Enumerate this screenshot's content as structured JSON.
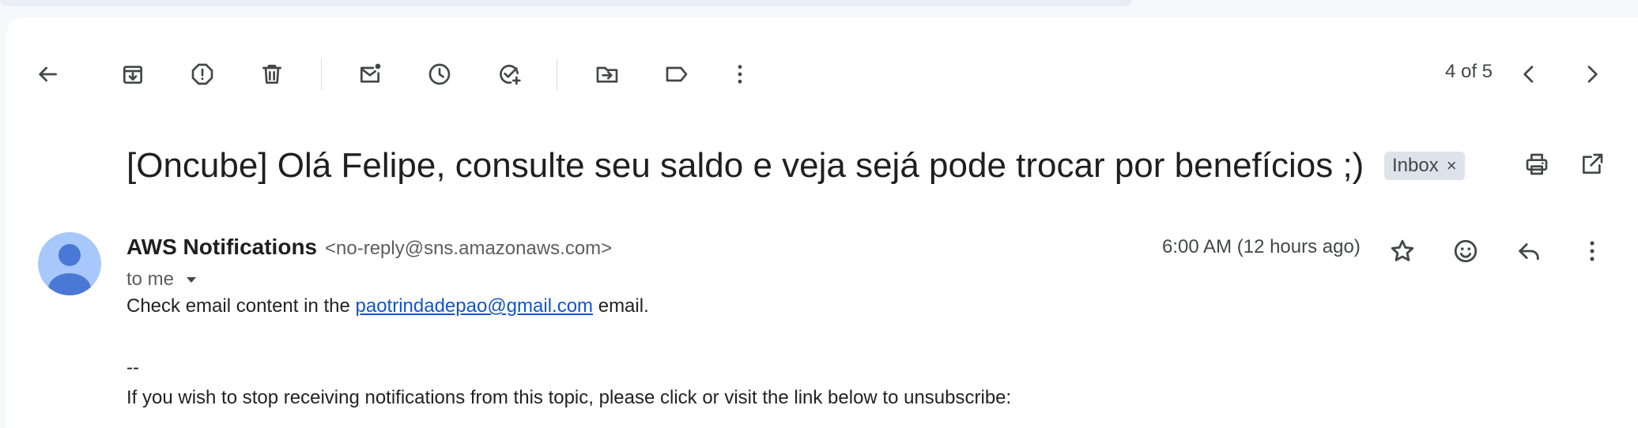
{
  "toolbar": {
    "back": "back-arrow-icon",
    "archive": "archive-icon",
    "report_spam": "report-spam-icon",
    "delete": "trash-icon",
    "mark_unread": "mark-unread-icon",
    "snooze": "clock-icon",
    "add_task": "add-task-icon",
    "move_to": "move-to-folder-icon",
    "label": "label-icon",
    "more": "more-vert-icon",
    "counter": "4 of 5"
  },
  "email": {
    "subject": "[Oncube] Olá Felipe, consulte seu saldo e veja sejá pode trocar por benefícios ;)",
    "label_badge": "Inbox",
    "label_remove": "×",
    "sender_name": "AWS Notifications",
    "sender_email": "<no-reply@sns.amazonaws.com>",
    "recipient": "to me",
    "time": "6:00 AM (12 hours ago)",
    "body": {
      "line1_prefix": "Check email content in the ",
      "line1_link": "paotrindadepao@gmail.com",
      "line1_suffix": " email.",
      "separator": "--",
      "line3": "If you wish to stop receiving notifications from this topic, please click or visit the link below to unsubscribe:"
    }
  },
  "colors": {
    "page_bg": "#f6f8fc",
    "card_bg": "#ffffff",
    "icon": "#444746",
    "link": "#1155cc",
    "avatar_bg": "#a8c7fa",
    "avatar_fg": "#4a78d6",
    "badge_bg": "#dde3ea"
  }
}
